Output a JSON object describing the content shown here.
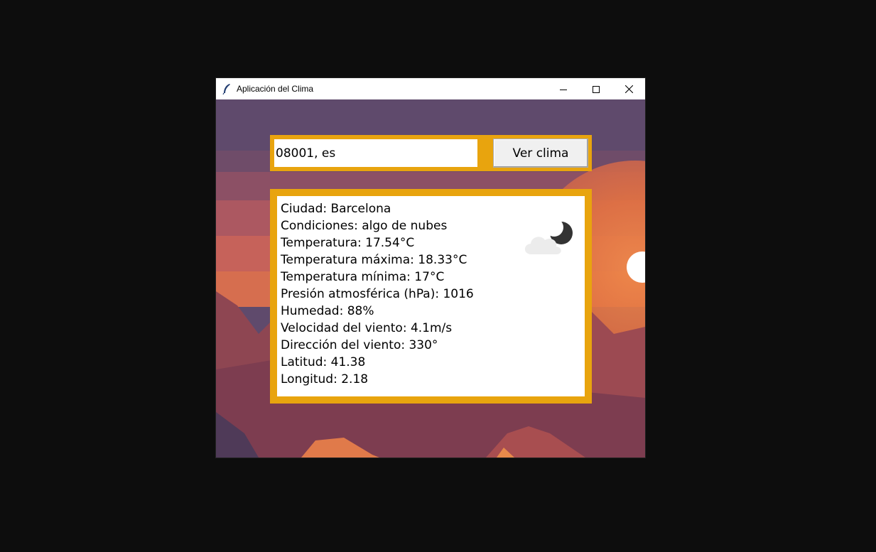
{
  "window": {
    "title": "Aplicación del Clima",
    "icon": "feather-icon",
    "controls": [
      "minimize-icon",
      "maximize-icon",
      "close-icon"
    ]
  },
  "search": {
    "value": "08001, es",
    "button_label": "Ver clima"
  },
  "weather": {
    "icon": "partly-cloudy-night-icon",
    "lines": [
      "Ciudad: Barcelona",
      "Condiciones: algo de nubes",
      "Temperatura: 17.54°C",
      "Temperatura máxima: 18.33°C",
      "Temperatura mínima: 17°C",
      "Presión atmosférica (hPa): 1016",
      "Humedad: 88%",
      "Velocidad del viento: 4.1m/s",
      "Dirección del viento: 330°",
      "Latitud: 41.38",
      "Longitud: 2.18"
    ]
  },
  "colors": {
    "frame": "#e8a40e",
    "screen_background": "#0d0d0d"
  }
}
